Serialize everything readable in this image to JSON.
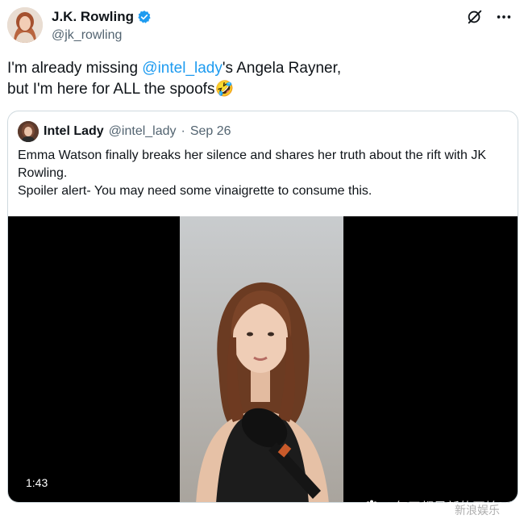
{
  "author": {
    "name": "J.K. Rowling",
    "handle": "@jk_rowling",
    "avatar_icon": "woman-portrait-avatar",
    "verified_icon": "verified-badge-icon",
    "verified_color": "#1d9bf0"
  },
  "top_actions": {
    "icons": [
      "grok-icon",
      "more-options-icon"
    ]
  },
  "tweet": {
    "line1_prefix": "I'm already missing ",
    "mention": "@intel_lady",
    "line1_suffix": "'s Angela Rayner,",
    "line2": "but I'm here for ALL the spoofs🤣"
  },
  "quote": {
    "name": "Intel Lady",
    "handle": "@intel_lady",
    "separator": "·",
    "date": "Sep 26",
    "text_line1": "Emma Watson finally breaks her silence and shares her truth about the rift with JK Rowling.",
    "text_line2": "Spoiler alert- You may need some vinaigrette to consume this.",
    "video": {
      "duration": "1:43",
      "subject": "woman-with-microphone"
    }
  },
  "watermark": {
    "text": "@每天都是新的开始MS",
    "secondary": "新浪娱乐"
  }
}
